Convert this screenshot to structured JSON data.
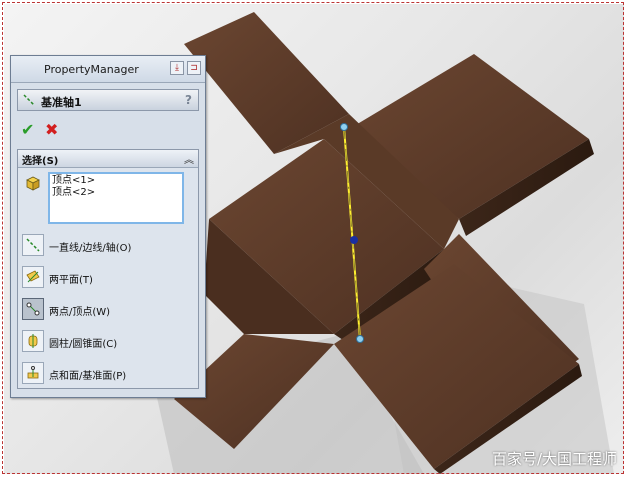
{
  "panel": {
    "title": "PropertyManager",
    "feature_name": "基准轴1",
    "help": "?",
    "section_title": "选择(S)",
    "selections": [
      "顶点<1>",
      "顶点<2>"
    ],
    "options": [
      {
        "label": "一直线/边线/轴(O)",
        "icon": "line-edge-axis-icon"
      },
      {
        "label": "两平面(T)",
        "icon": "two-planes-icon"
      },
      {
        "label": "两点/顶点(W)",
        "icon": "two-points-icon",
        "active": true
      },
      {
        "label": "圆柱/圆锥面(C)",
        "icon": "cylinder-cone-icon"
      },
      {
        "label": "点和面/基准面(P)",
        "icon": "point-face-icon"
      }
    ]
  },
  "watermark": "百家号/大国工程师",
  "colors": {
    "wood": "#5c3b28",
    "axis": "#ffef30",
    "panel": "#d7dfe9"
  }
}
